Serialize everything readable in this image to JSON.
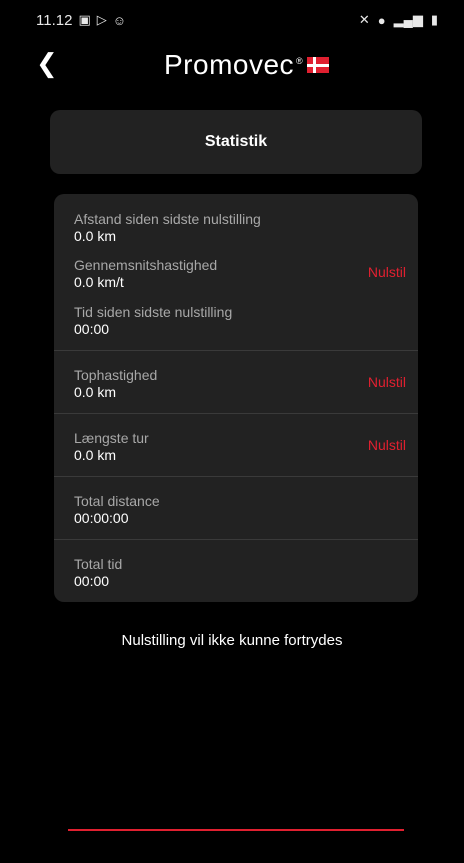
{
  "status_bar": {
    "time": "11.12",
    "left_icons": [
      "image-icon",
      "play-icon",
      "smiley-icon"
    ],
    "right_icons": [
      "mute-icon",
      "location-icon",
      "signal-icon",
      "battery-icon"
    ]
  },
  "header": {
    "logo_text": "Promovec",
    "logo_reg": "®",
    "back_icon": "chevron-left-icon"
  },
  "title": "Statistik",
  "stats": {
    "group1": {
      "distance_label": "Afstand siden sidste nulstilling",
      "distance_value": "0.0 km",
      "avg_speed_label": "Gennemsnitshastighed",
      "avg_speed_value": "0.0 km/t",
      "time_label": "Tid siden sidste nulstilling",
      "time_value": "00:00",
      "reset_label": "Nulstil"
    },
    "top_speed": {
      "label": "Tophastighed",
      "value": "0.0 km",
      "reset_label": "Nulstil"
    },
    "longest_trip": {
      "label": "Længste tur",
      "value": "0.0 km",
      "reset_label": "Nulstil"
    },
    "total_distance": {
      "label": "Total distance",
      "value": "00:00:00"
    },
    "total_time": {
      "label": "Total tid",
      "value": "00:00"
    }
  },
  "note": "Nulstilling vil ikke kunne fortrydes",
  "colors": {
    "accent": "#e02030",
    "card": "#222222",
    "background": "#000000"
  }
}
